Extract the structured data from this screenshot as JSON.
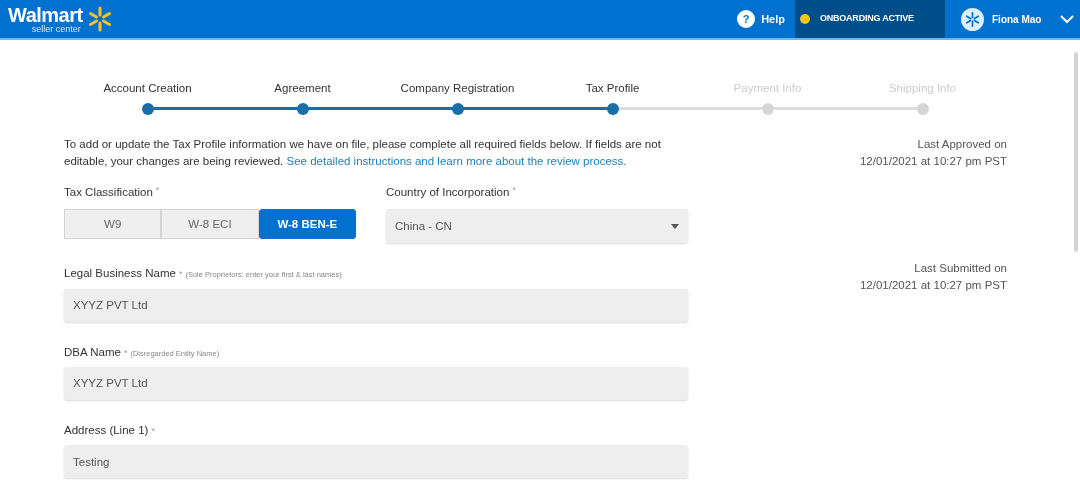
{
  "header": {
    "logo": {
      "wordmark": "Walmart",
      "tagline": "seller center"
    },
    "help": "Help",
    "help_glyph": "?",
    "status": "ONBOARDING ACTIVE",
    "user": "Fiona Mao"
  },
  "steps": [
    {
      "label": "Account Creation",
      "completed": true
    },
    {
      "label": "Agreement",
      "completed": true
    },
    {
      "label": "Company Registration",
      "completed": true
    },
    {
      "label": "Tax Profile",
      "completed": true
    },
    {
      "label": "Payment Info",
      "completed": false
    },
    {
      "label": "Shipping Info",
      "completed": false
    }
  ],
  "intro": {
    "text": "To add or update the Tax Profile information we have on file, please complete all required fields below. If fields are not editable, your changes are being reviewed.",
    "link": "See detailed instructions and learn more about the review process."
  },
  "tax_classification": {
    "label": "Tax Classification",
    "required_mark": "*",
    "options": [
      {
        "label": "W9",
        "selected": false
      },
      {
        "label": "W-8 ECI",
        "selected": false
      },
      {
        "label": "W-8 BEN-E",
        "selected": true
      }
    ]
  },
  "country": {
    "label": "Country of Incorporation",
    "required_mark": "*",
    "value": "China - CN"
  },
  "fields": [
    {
      "label": "Legal Business Name",
      "required_mark": "*",
      "hint": "(Sole Proprietors: enter your first & last names)",
      "value": "XYYZ PVT Ltd"
    },
    {
      "label": "DBA Name",
      "required_mark": "*",
      "hint": "(Disregarded Entity Name)",
      "value": "XYYZ PVT Ltd"
    },
    {
      "label": "Address (Line 1)",
      "required_mark": "*",
      "value": "Testing"
    }
  ],
  "last_approved": {
    "label": "Last Approved on",
    "date": "12/01/2021 at 10:27 pm PST"
  },
  "last_submitted": {
    "label": "Last Submitted on",
    "date": "12/01/2021 at 10:27 pm PST"
  }
}
